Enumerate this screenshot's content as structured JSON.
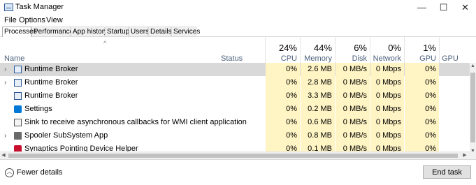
{
  "window": {
    "title": "Task Manager",
    "minimize_glyph": "—",
    "maximize_glyph": "☐",
    "close_glyph": "✕"
  },
  "menu": [
    "File",
    "Options",
    "View"
  ],
  "tabs": [
    "Processes",
    "Performance",
    "App history",
    "Startup",
    "Users",
    "Details",
    "Services"
  ],
  "active_tab": "Processes",
  "columns": {
    "name": "Name",
    "status": "Status",
    "cpu": {
      "pct": "24%",
      "label": "CPU"
    },
    "memory": {
      "pct": "44%",
      "label": "Memory"
    },
    "disk": {
      "pct": "6%",
      "label": "Disk"
    },
    "network": {
      "pct": "0%",
      "label": "Network"
    },
    "gpu": {
      "pct": "1%",
      "label": "GPU"
    },
    "gpu_engine": {
      "label": "GPU Engine"
    }
  },
  "sort_glyph": "^",
  "rows": [
    {
      "name": "Runtime Broker",
      "expand": "›",
      "icon": "runtime-broker-icon",
      "cpu": "0%",
      "memory": "2.6 MB",
      "disk": "0 MB/s",
      "network": "0 Mbps",
      "gpu": "0%"
    },
    {
      "name": "Runtime Broker",
      "expand": "›",
      "icon": "runtime-broker-icon",
      "cpu": "0%",
      "memory": "2.8 MB",
      "disk": "0 MB/s",
      "network": "0 Mbps",
      "gpu": "0%"
    },
    {
      "name": "Runtime Broker",
      "expand": "",
      "icon": "runtime-broker-icon",
      "cpu": "0%",
      "memory": "3.3 MB",
      "disk": "0 MB/s",
      "network": "0 Mbps",
      "gpu": "0%"
    },
    {
      "name": "Settings",
      "expand": "",
      "icon": "settings-gear-icon",
      "cpu": "0%",
      "memory": "0.2 MB",
      "disk": "0 MB/s",
      "network": "0 Mbps",
      "gpu": "0%"
    },
    {
      "name": "Sink to receive asynchronous callbacks for WMI client application",
      "expand": "",
      "icon": "wmi-sink-icon",
      "cpu": "0%",
      "memory": "0.6 MB",
      "disk": "0 MB/s",
      "network": "0 Mbps",
      "gpu": "0%"
    },
    {
      "name": "Spooler SubSystem App",
      "expand": "›",
      "icon": "printer-icon",
      "cpu": "0%",
      "memory": "0.8 MB",
      "disk": "0 MB/s",
      "network": "0 Mbps",
      "gpu": "0%"
    },
    {
      "name": "Synaptics Pointing Device Helper",
      "expand": "",
      "icon": "synaptics-icon",
      "cpu": "0%",
      "memory": "0.1 MB",
      "disk": "0 MB/s",
      "network": "0 Mbps",
      "gpu": "0%"
    }
  ],
  "footer": {
    "fewer_details": "Fewer details",
    "end_task": "End task"
  },
  "colors": {
    "heat": "#fff4c4",
    "header_text": "#4c607a",
    "row_highlight": "#d9d9d9"
  }
}
